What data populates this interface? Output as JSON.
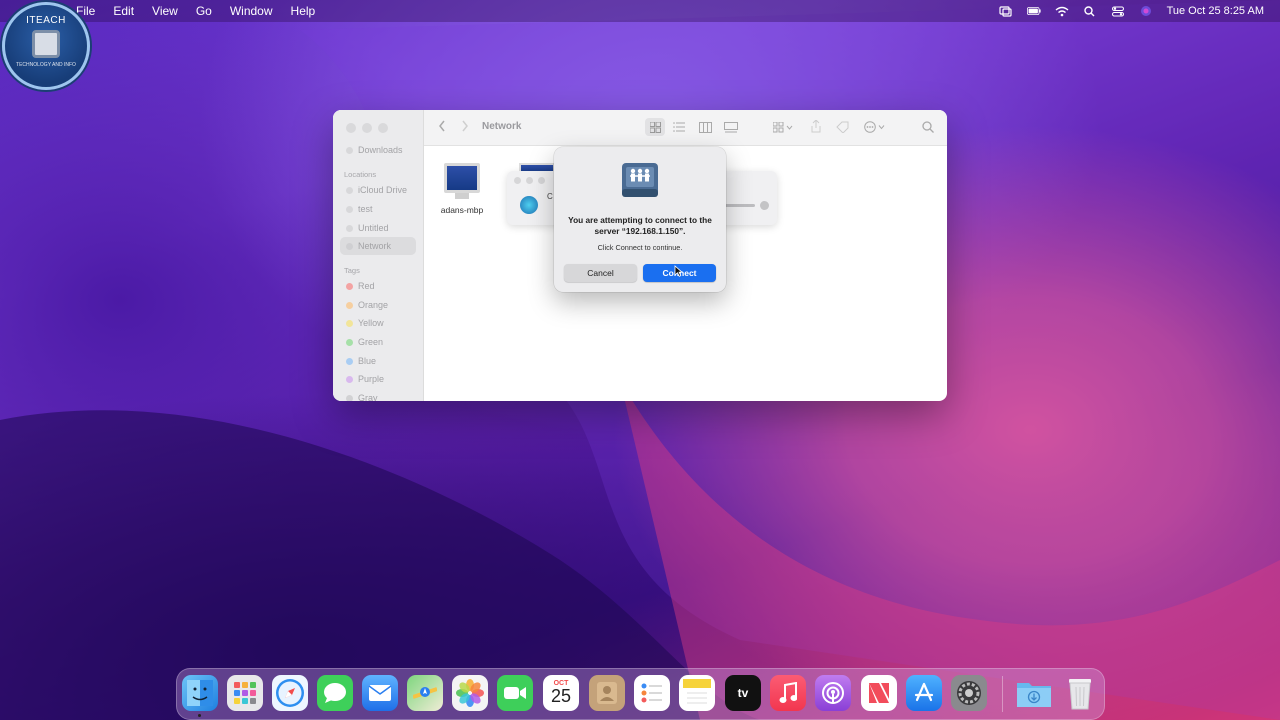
{
  "menubar": {
    "app_icon": "apple-logo",
    "menus": [
      "File",
      "Edit",
      "View",
      "Go",
      "Window",
      "Help"
    ],
    "datetime": "Tue Oct 25  8:25 AM"
  },
  "logo": {
    "title": "ITEACH",
    "subtitle": "TECHNOLOGY AND INFO"
  },
  "finder": {
    "title": "Network",
    "sidebar": {
      "favorites": [
        "Downloads"
      ],
      "locations_header": "Locations",
      "locations": [
        "iCloud Drive",
        "test",
        "Untitled",
        "Network"
      ],
      "selected": "Network",
      "tags_header": "Tags",
      "tags": [
        {
          "label": "Red",
          "color": "#ff6b6b"
        },
        {
          "label": "Orange",
          "color": "#ffb457"
        },
        {
          "label": "Yellow",
          "color": "#f4dc4b"
        },
        {
          "label": "Green",
          "color": "#67d36b"
        },
        {
          "label": "Blue",
          "color": "#5aa9ff"
        },
        {
          "label": "Purple",
          "color": "#c58ae8"
        },
        {
          "label": "Gray",
          "color": "#b5b5b8"
        }
      ]
    },
    "items": [
      {
        "label": "adans-mbp",
        "icon": "imac-icon"
      }
    ],
    "ghost_dialog_letter": "C"
  },
  "dialog": {
    "message": "You are attempting to connect to the server “192.168.1.150”.",
    "sub": "Click Connect to continue.",
    "cancel_label": "Cancel",
    "connect_label": "Connect",
    "icon": "file-server-icon"
  },
  "dock": {
    "apps": [
      {
        "name": "Finder",
        "color": "#3aa0f0"
      },
      {
        "name": "Launchpad",
        "color": "#e8e8ea"
      },
      {
        "name": "Safari",
        "color": "#2e8ff0"
      },
      {
        "name": "Messages",
        "color": "#3ed05a"
      },
      {
        "name": "Mail",
        "color": "#3a8cf4"
      },
      {
        "name": "Maps",
        "color": "#66c46a"
      },
      {
        "name": "Photos",
        "color": "#f4f4f4"
      },
      {
        "name": "FaceTime",
        "color": "#3ecf5a"
      },
      {
        "name": "Calendar",
        "color": "#ffffff"
      },
      {
        "name": "Contacts",
        "color": "#c4a27a"
      },
      {
        "name": "Reminders",
        "color": "#ffffff"
      },
      {
        "name": "Notes",
        "color": "#f6e27a"
      },
      {
        "name": "TV",
        "color": "#111111"
      },
      {
        "name": "Music",
        "color": "#fb3c5c"
      },
      {
        "name": "Podcasts",
        "color": "#9b4fe0"
      },
      {
        "name": "News",
        "color": "#f24c5b"
      },
      {
        "name": "App Store",
        "color": "#2b8ff6"
      },
      {
        "name": "System Preferences",
        "color": "#8a8a8e"
      },
      {
        "name": "Downloads",
        "color": "#5ab4f0"
      },
      {
        "name": "Trash",
        "color": "#e7e7ea"
      }
    ],
    "calendar_month": "OCT",
    "calendar_day": "25",
    "tv_label": "tv"
  }
}
